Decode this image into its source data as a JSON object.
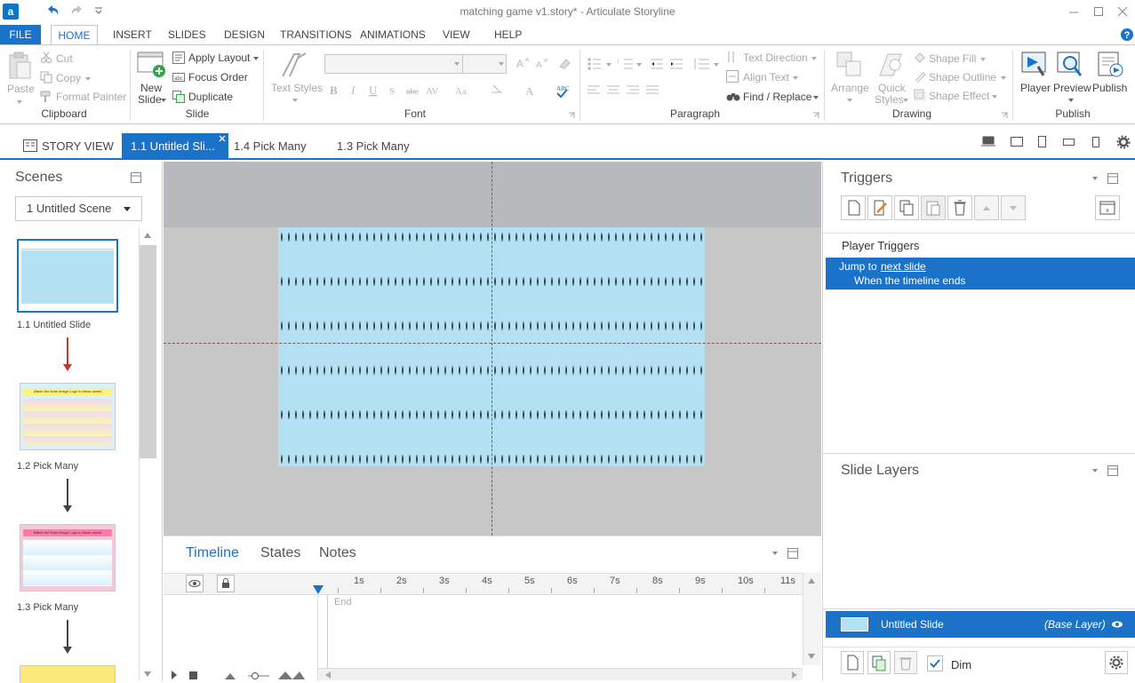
{
  "window": {
    "title": "matching game v1.story* - Articulate Storyline",
    "app_icon": "a"
  },
  "ribbon_tabs": [
    "FILE",
    "HOME",
    "INSERT",
    "SLIDES",
    "DESIGN",
    "TRANSITIONS",
    "ANIMATIONS",
    "VIEW",
    "HELP"
  ],
  "clipboard": {
    "paste": "Paste",
    "cut": "Cut",
    "copy": "Copy",
    "format_painter": "Format Painter",
    "label": "Clipboard"
  },
  "slide_group": {
    "new_slide_1": "New",
    "new_slide_2": "Slide",
    "apply_layout": "Apply Layout",
    "focus_order": "Focus Order",
    "duplicate": "Duplicate",
    "label": "Slide"
  },
  "font_group": {
    "text_styles": "Text Styles",
    "label": "Font"
  },
  "paragraph_group": {
    "text_direction": "Text Direction",
    "align_text": "Align Text",
    "find_replace": "Find / Replace",
    "label": "Paragraph"
  },
  "drawing_group": {
    "arrange": "Arrange",
    "quick_styles_1": "Quick",
    "quick_styles_2": "Styles",
    "shape_fill": "Shape Fill",
    "shape_outline": "Shape Outline",
    "shape_effect": "Shape Effect",
    "label": "Drawing"
  },
  "publish_group": {
    "player": "Player",
    "preview": "Preview",
    "publish": "Publish",
    "label": "Publish"
  },
  "doc_tabs": {
    "story_view": "STORY VIEW",
    "active": "1.1 Untitled Sli...",
    "tab2": "1.4 Pick Many",
    "tab3": "1.3 Pick Many"
  },
  "scenes": {
    "title": "Scenes",
    "selected_scene": "1 Untitled Scene",
    "slides": [
      {
        "label": "1.1 Untitled Slide"
      },
      {
        "label": "1.2 Pick Many",
        "header": "Match the Note Image Logo to these dolest"
      },
      {
        "label": "1.3 Pick Many",
        "header": "Match the Note Image Logo to these dolest"
      }
    ]
  },
  "timeline": {
    "tabs": [
      "Timeline",
      "States",
      "Notes"
    ],
    "ticks": [
      "1s",
      "2s",
      "3s",
      "4s",
      "5s",
      "6s",
      "7s",
      "8s",
      "9s",
      "10s",
      "11s"
    ],
    "end_label": "End"
  },
  "triggers": {
    "title": "Triggers",
    "section": "Player Triggers",
    "item_prefix": "Jump to",
    "item_link": "next slide",
    "item_condition": "When the timeline ends"
  },
  "layers": {
    "title": "Slide Layers",
    "base_name": "Untitled Slide",
    "base_tag": "(Base Layer)",
    "dim_label": "Dim"
  },
  "colors": {
    "accent": "#1a73c8",
    "slide_bg": "#b3e1f3",
    "canvas": "#c7c7c7"
  }
}
